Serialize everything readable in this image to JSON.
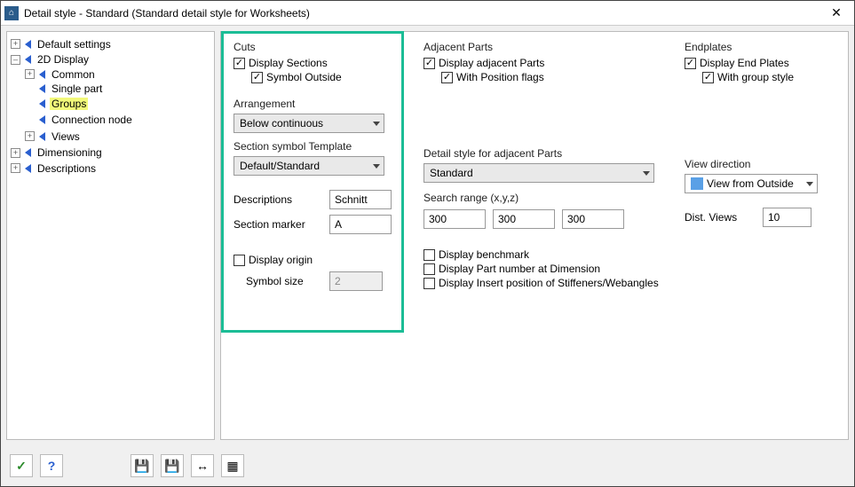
{
  "window": {
    "title": "Detail style - Standard (Standard detail style for Worksheets)"
  },
  "tree": {
    "default_settings": "Default settings",
    "display_2d": "2D Display",
    "common": "Common",
    "single_part": "Single part",
    "groups": "Groups",
    "connection_node": "Connection node",
    "views": "Views",
    "dimensioning": "Dimensioning",
    "descriptions": "Descriptions"
  },
  "cuts": {
    "title": "Cuts",
    "display_sections": "Display Sections",
    "symbol_outside": "Symbol Outside",
    "arrangement_label": "Arrangement",
    "arrangement_value": "Below continuous",
    "template_label": "Section symbol Template",
    "template_value": "Default/Standard",
    "descriptions_label": "Descriptions",
    "descriptions_value": "Schnitt",
    "marker_label": "Section marker",
    "marker_value": "A"
  },
  "origin": {
    "display_origin": "Display origin",
    "symbol_size_label": "Symbol size",
    "symbol_size_value": "2"
  },
  "adjacent": {
    "title": "Adjacent Parts",
    "display_adjacent": "Display adjacent Parts",
    "with_position_flags": "With Position flags",
    "style_label": "Detail style for adjacent Parts",
    "style_value": "Standard",
    "search_label": "Search range (x,y,z)",
    "sx": "300",
    "sy": "300",
    "sz": "300"
  },
  "benchmarks": {
    "display_benchmark": "Display benchmark",
    "display_partnum": "Display Part number at Dimension",
    "display_insert": "Display Insert position of Stiffeners/Webangles"
  },
  "endplates": {
    "title": "Endplates",
    "display_end_plates": "Display End Plates",
    "with_group_style": "With group style"
  },
  "viewdir": {
    "title": "View direction",
    "value": "View from Outside",
    "dist_label": "Dist. Views",
    "dist_value": "10"
  },
  "icons": {
    "check": "✓",
    "help": "?",
    "save": "💾",
    "saveall": "💾",
    "swap": "↔",
    "grid": "▦"
  }
}
